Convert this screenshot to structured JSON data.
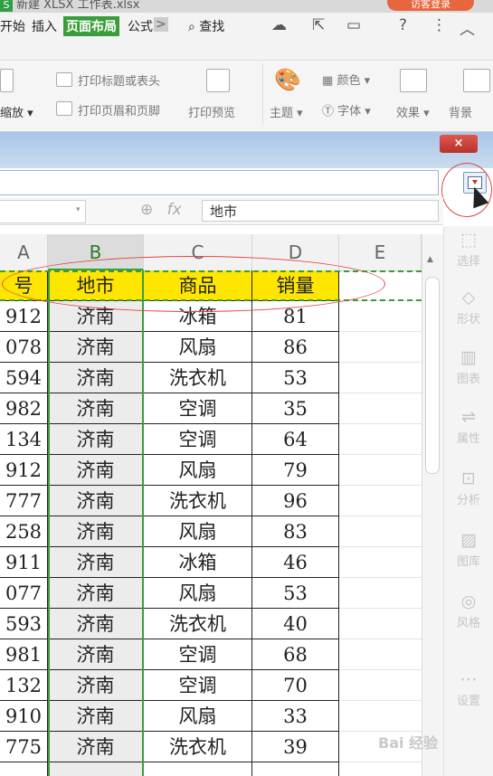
{
  "titlebar": {
    "logo": "S",
    "doc_title": "新建 XLSX 工作表.xlsx",
    "login": "访客登录"
  },
  "menubar": {
    "items": [
      "开始",
      "插入",
      "页面布局",
      "公式"
    ],
    "active": "页面布局",
    "more": ">",
    "search": "查找",
    "icons": [
      "cloud-icon",
      "share-icon",
      "more-icon",
      "help-icon",
      "kebab-icon",
      "collapse-ribbon-icon"
    ]
  },
  "ribbon": {
    "zoom_label": "缩放",
    "print_titles": "打印标题或表头",
    "print_header_footer": "打印页眉和页脚",
    "print_preview": "打印预览",
    "color": "颜色",
    "theme": "主题",
    "font": "字体",
    "effects": "效果",
    "background": "背景"
  },
  "dialog": {
    "close": "×"
  },
  "formula_bar": {
    "fx": "fx",
    "value": "地市"
  },
  "columns": [
    "A",
    "B",
    "C",
    "D",
    "E"
  ],
  "selected_column": "B",
  "table": {
    "headers": [
      "号",
      "地市",
      "商品",
      "销量"
    ],
    "rows": [
      [
        "912",
        "济南",
        "冰箱",
        "81"
      ],
      [
        "078",
        "济南",
        "风扇",
        "86"
      ],
      [
        "594",
        "济南",
        "洗衣机",
        "53"
      ],
      [
        "982",
        "济南",
        "空调",
        "35"
      ],
      [
        "134",
        "济南",
        "空调",
        "64"
      ],
      [
        "912",
        "济南",
        "风扇",
        "79"
      ],
      [
        "777",
        "济南",
        "洗衣机",
        "96"
      ],
      [
        "258",
        "济南",
        "风扇",
        "83"
      ],
      [
        "911",
        "济南",
        "冰箱",
        "46"
      ],
      [
        "077",
        "济南",
        "风扇",
        "53"
      ],
      [
        "593",
        "济南",
        "洗衣机",
        "40"
      ],
      [
        "981",
        "济南",
        "空调",
        "68"
      ],
      [
        "132",
        "济南",
        "空调",
        "70"
      ],
      [
        "910",
        "济南",
        "风扇",
        "33"
      ],
      [
        "775",
        "济南",
        "洗衣机",
        "39"
      ]
    ]
  },
  "side_panel": [
    "选择",
    "形状",
    "图表",
    "属性",
    "分析",
    "图库",
    "风格",
    "设置"
  ],
  "watermark": "Bai 经验",
  "colors": {
    "accent": "#3a9d3a",
    "header_fill": "#ffe600",
    "annotation": "#e04545"
  }
}
